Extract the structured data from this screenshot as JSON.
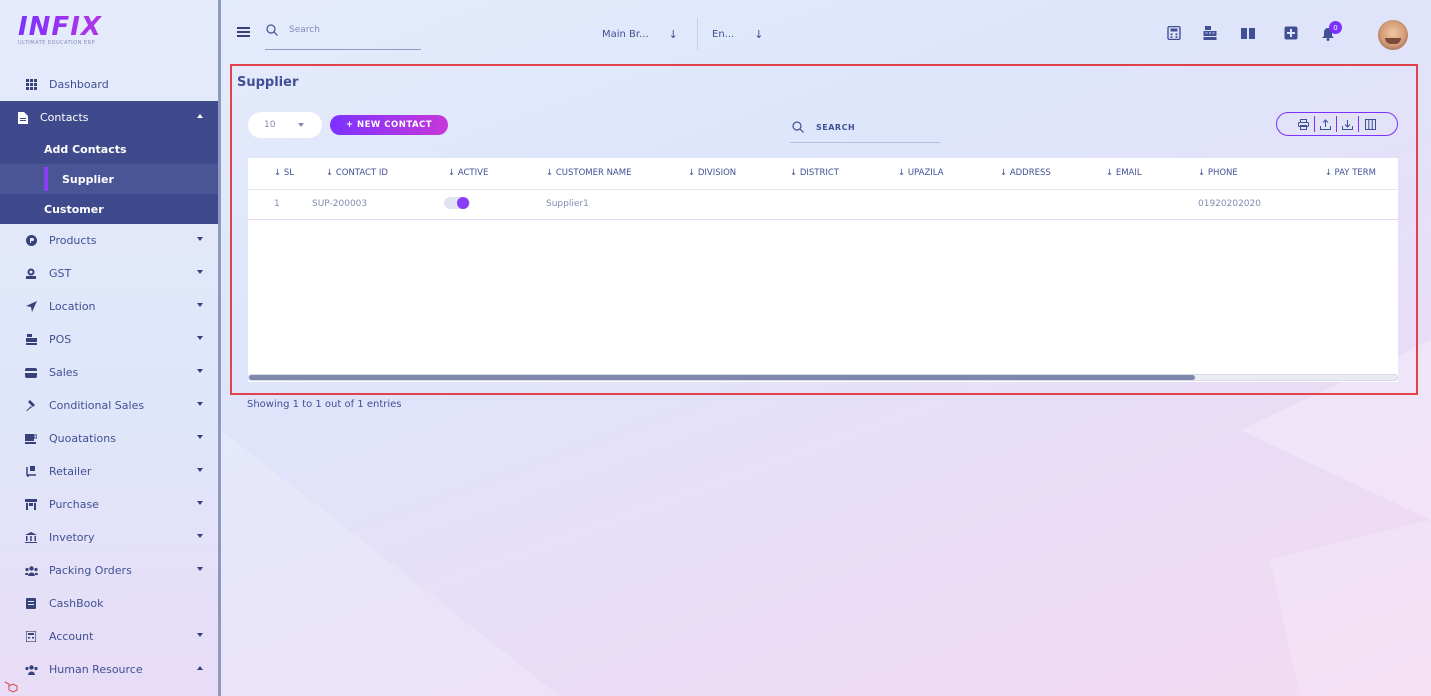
{
  "app": {
    "logo_text": "INFIX",
    "logo_tagline": "ULTIMATE EDUCATION ERP"
  },
  "topbar": {
    "search_placeholder": "Search",
    "branch_selector": "Main Br...",
    "language_selector": "En...",
    "notification_count": "0"
  },
  "sidebar": {
    "items": [
      {
        "label": "Dashboard",
        "icon": "grid-icon"
      },
      {
        "label": "Contacts",
        "icon": "file-icon",
        "expanded": true
      },
      {
        "label": "Products",
        "icon": "product-icon"
      },
      {
        "label": "GST",
        "icon": "gst-icon"
      },
      {
        "label": "Location",
        "icon": "location-arrow-icon"
      },
      {
        "label": "POS",
        "icon": "cash-register-icon"
      },
      {
        "label": "Sales",
        "icon": "card-icon"
      },
      {
        "label": "Conditional Sales",
        "icon": "hammer-icon"
      },
      {
        "label": "Quoatations",
        "icon": "mug-icon"
      },
      {
        "label": "Retailer",
        "icon": "dolly-icon"
      },
      {
        "label": "Purchase",
        "icon": "store-icon"
      },
      {
        "label": "Invetory",
        "icon": "bank-icon"
      },
      {
        "label": "Packing Orders",
        "icon": "users-icon"
      },
      {
        "label": "CashBook",
        "icon": "book-icon"
      },
      {
        "label": "Account",
        "icon": "calculator-icon"
      },
      {
        "label": "Human Resource",
        "icon": "users-icon"
      }
    ],
    "contacts_sub": {
      "add_contacts": "Add Contacts",
      "supplier": "Supplier",
      "customer": "Customer"
    }
  },
  "main": {
    "title": "Supplier",
    "page_size": "10",
    "new_contact_label": "+ NEW CONTACT",
    "search_placeholder": "SEARCH",
    "columns": [
      "↓ SL",
      "↓ CONTACT ID",
      "↓ ACTIVE",
      "↓ CUSTOMER NAME",
      "↓ DIVISION",
      "↓ DISTRICT",
      "↓ UPAZILA",
      "↓ ADDRESS",
      "↓ EMAIL",
      "↓ PHONE",
      "↓ PAY TERM"
    ],
    "rows": [
      {
        "sl": "1",
        "contact_id": "SUP-200003",
        "active": true,
        "customer_name": "Supplier1",
        "division": "",
        "district": "",
        "upazila": "",
        "address": "",
        "email": "",
        "phone": "01920202020",
        "pay_term": ""
      }
    ],
    "footer": "Showing 1 to 1 out of 1 entries"
  },
  "colors": {
    "accent": "#7c32ff",
    "accent2": "#c738d8",
    "sidebar_active": "#3f4a8c",
    "text": "#415094",
    "highlight_border": "#e2434b"
  }
}
